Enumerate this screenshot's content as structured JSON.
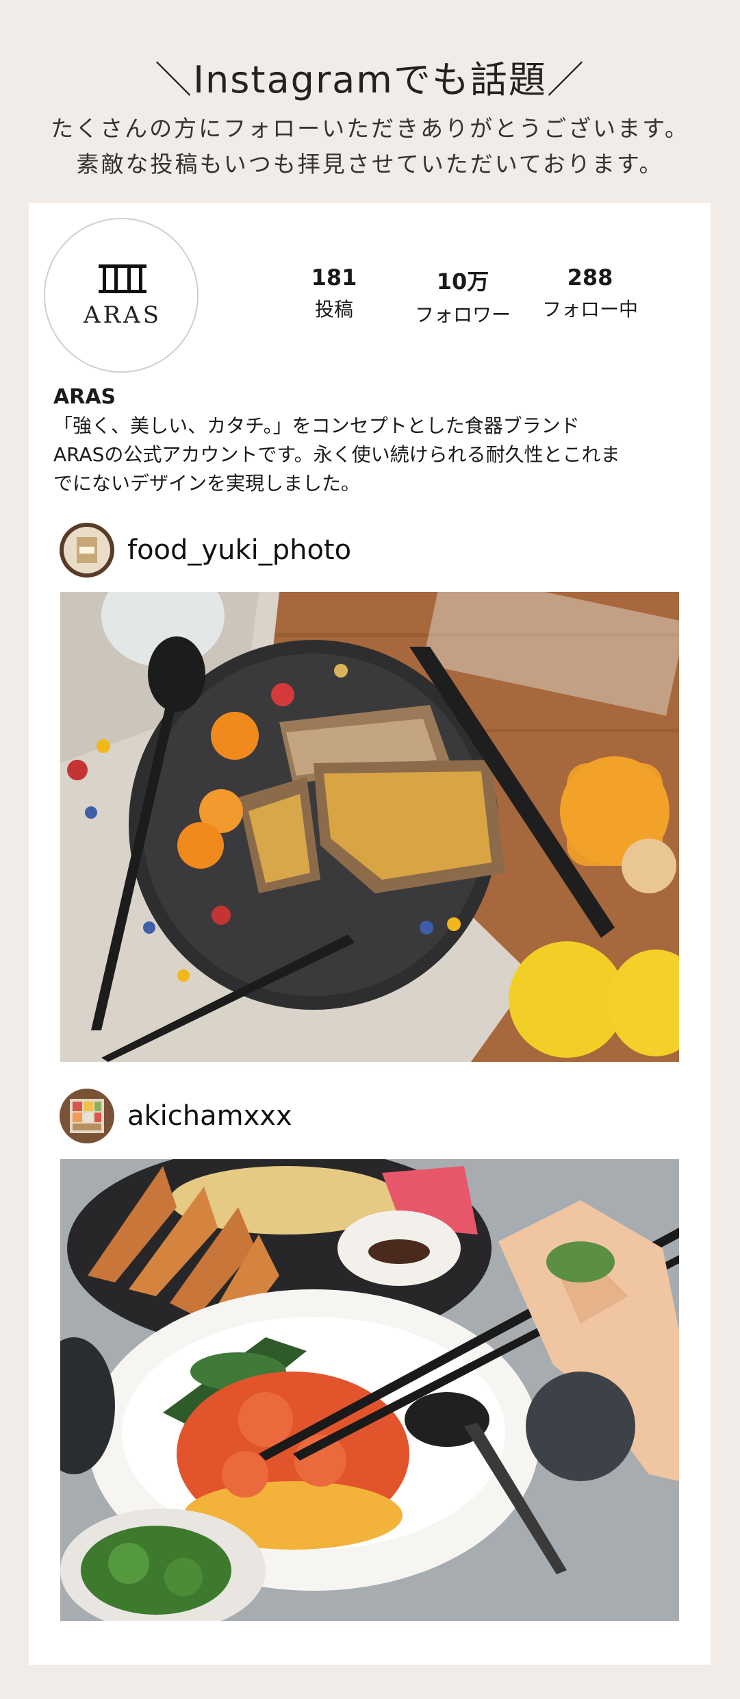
{
  "header": {
    "headline": "＼Instagramでも話題／",
    "intro_line1": "たくさんの方にフォローいただきありがとうございます。",
    "intro_line2": "素敵な投稿もいつも拝見させていただいております。"
  },
  "profile": {
    "avatar_text": "ARAS",
    "stats": [
      {
        "value": "181",
        "label": "投稿"
      },
      {
        "value": "10万",
        "label": "フォロワー"
      },
      {
        "value": "288",
        "label": "フォロー中"
      }
    ],
    "name": "ARAS",
    "bio_line1": "「強く、美しい、カタチ。」をコンセプトとした食器ブランド",
    "bio_line2": "ARASの公式アカウントです。永く使い続けられる耐久性とこれま",
    "bio_line3": "でにないデザインを実現しました。"
  },
  "posts": [
    {
      "username": "food_yuki_photo",
      "photo": "bread-with-marmalade-on-black-plate"
    },
    {
      "username": "akichamxxx",
      "photo": "shrimp-chili-and-gyoza-with-chopsticks"
    }
  ],
  "colors": {
    "page_bg": "#f2ece9",
    "card_bg": "#ffffff",
    "text": "#1a1a1a"
  }
}
